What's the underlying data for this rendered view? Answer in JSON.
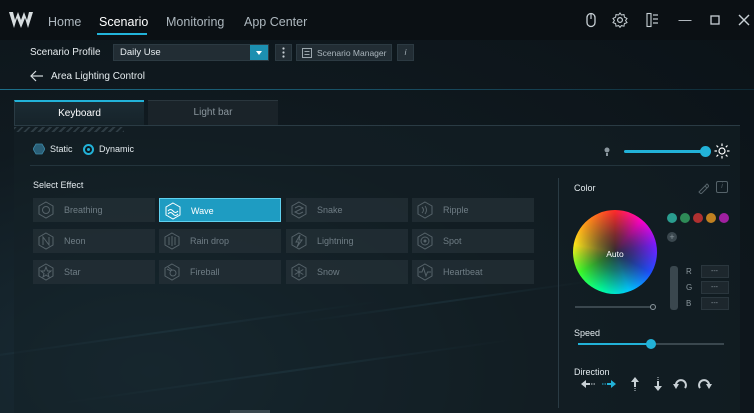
{
  "nav": {
    "tabs": [
      "Home",
      "Scenario",
      "Monitoring",
      "App Center"
    ],
    "active": "Scenario"
  },
  "profile": {
    "label": "Scenario Profile",
    "selected": "Daily Use",
    "manager_button": "Scenario Manager",
    "info_button": "i"
  },
  "breadcrumb": {
    "title": "Area Lighting Control"
  },
  "device_tabs": [
    "Keyboard",
    "Light bar"
  ],
  "mode": {
    "static_label": "Static",
    "dynamic_label": "Dynamic",
    "selected": "Dynamic"
  },
  "brightness": {
    "level": 0.95
  },
  "effects": {
    "title": "Select Effect",
    "items": [
      {
        "label": "Breathing",
        "selected": false
      },
      {
        "label": "Wave",
        "selected": true
      },
      {
        "label": "Snake",
        "selected": false
      },
      {
        "label": "Ripple",
        "selected": false
      },
      {
        "label": "Neon",
        "selected": false
      },
      {
        "label": "Rain drop",
        "selected": false
      },
      {
        "label": "Lightning",
        "selected": false
      },
      {
        "label": "Spot",
        "selected": false
      },
      {
        "label": "Star",
        "selected": false
      },
      {
        "label": "Fireball",
        "selected": false
      },
      {
        "label": "Snow",
        "selected": false
      },
      {
        "label": "Heartbeat",
        "selected": false
      }
    ]
  },
  "color": {
    "title": "Color",
    "wheel_label": "Auto",
    "swatches": [
      "#2a9d8f",
      "#2e8b57",
      "#b03030",
      "#c08020",
      "#a020a0"
    ],
    "add_label": "+",
    "r_label": "R",
    "g_label": "G",
    "b_label": "B",
    "r_value": "---",
    "g_value": "---",
    "b_value": "---"
  },
  "speed": {
    "title": "Speed",
    "level": 0.5
  },
  "direction": {
    "title": "Direction"
  },
  "colors": {
    "accent": "#22b2d8",
    "selected_effect": "#1e9cc2"
  }
}
